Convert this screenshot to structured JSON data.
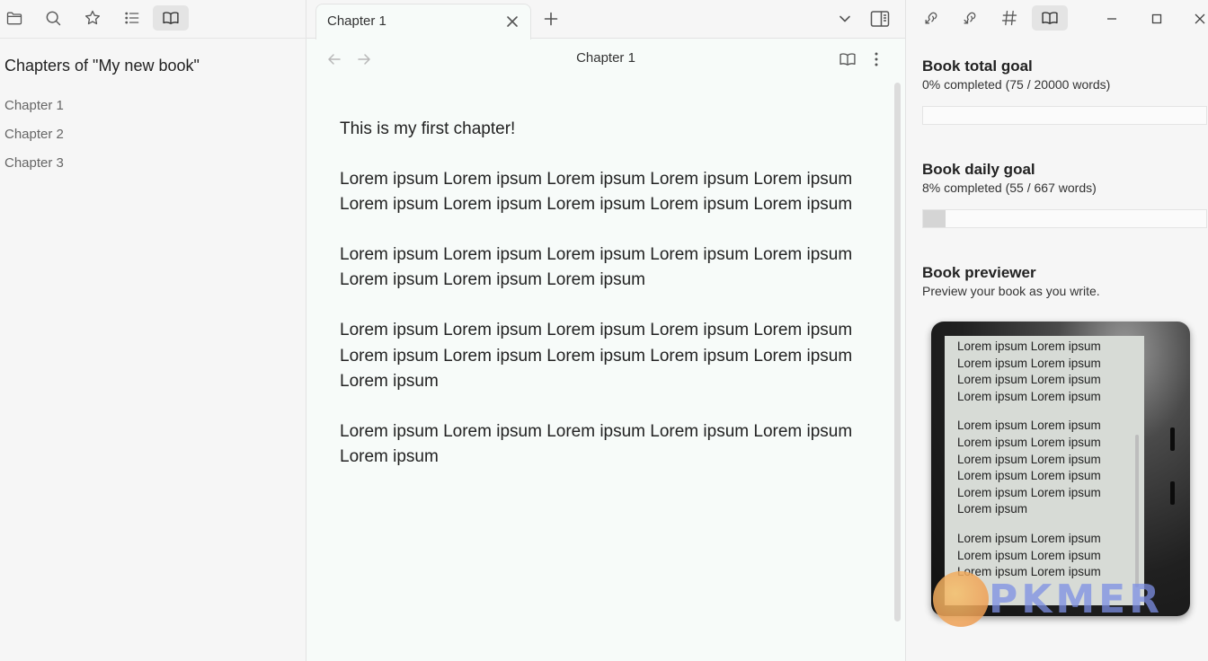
{
  "left_sidebar": {
    "toolbar_icons": [
      "folder-icon",
      "search-icon",
      "star-icon",
      "list-icon",
      "book-icon"
    ],
    "title": "Chapters of \"My new book\"",
    "chapters": [
      "Chapter 1",
      "Chapter 2",
      "Chapter 3"
    ]
  },
  "tabs": {
    "active_tab": "Chapter 1"
  },
  "view": {
    "title": "Chapter 1",
    "paragraphs": [
      "This is my first chapter!",
      "Lorem ipsum Lorem ipsum Lorem ipsum Lorem ipsum Lorem ipsum Lorem ipsum Lorem ipsum Lorem ipsum Lorem ipsum Lorem ipsum",
      "Lorem ipsum Lorem ipsum Lorem ipsum Lorem ipsum Lorem ipsum Lorem ipsum Lorem ipsum Lorem ipsum",
      "Lorem ipsum Lorem ipsum Lorem ipsum Lorem ipsum Lorem ipsum Lorem ipsum Lorem ipsum Lorem ipsum Lorem ipsum Lorem ipsum Lorem ipsum",
      "Lorem ipsum Lorem ipsum Lorem ipsum Lorem ipsum Lorem ipsum Lorem ipsum"
    ]
  },
  "right_sidebar": {
    "toolbar_icons": [
      "backlinks-icon",
      "outgoing-links-icon",
      "tags-icon",
      "book-icon"
    ],
    "total_goal": {
      "title": "Book total goal",
      "text": "0% completed (75 / 20000 words)",
      "progress": 0
    },
    "daily_goal": {
      "title": "Book daily goal",
      "text": "8% completed (55 / 667 words)",
      "progress": 0.08
    },
    "previewer": {
      "title": "Book previewer",
      "subtitle": "Preview your book as you write.",
      "paragraphs": [
        "Lorem ipsum Lorem ipsum Lorem ipsum Lorem ipsum Lorem ipsum Lorem ipsum Lorem ipsum Lorem ipsum",
        "Lorem ipsum Lorem ipsum Lorem ipsum Lorem ipsum Lorem ipsum Lorem ipsum Lorem ipsum Lorem ipsum Lorem ipsum Lorem ipsum Lorem ipsum",
        "Lorem ipsum Lorem ipsum Lorem ipsum Lorem ipsum Lorem ipsum Lorem ipsum"
      ]
    }
  },
  "watermark": "PKMER"
}
